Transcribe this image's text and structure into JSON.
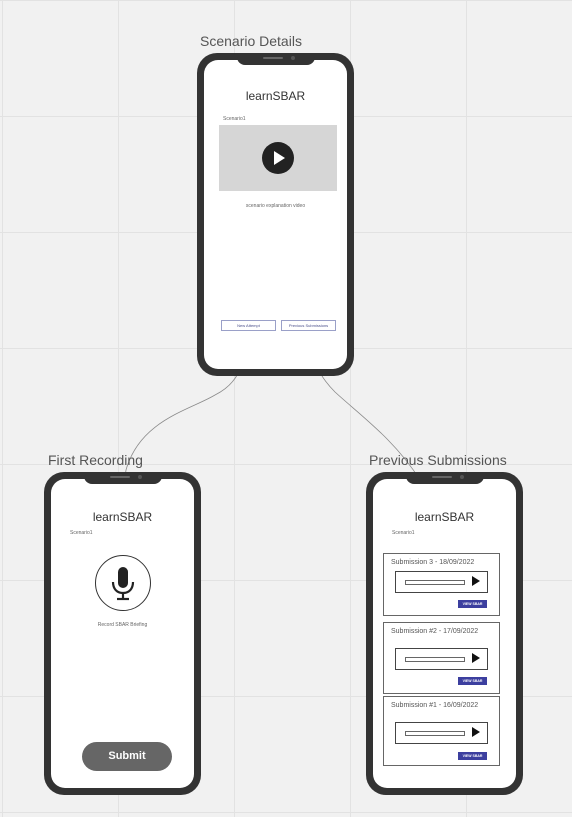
{
  "frames": {
    "scenario_details": {
      "title": "Scenario Details",
      "app_title": "learnSBAR",
      "scenario_label": "Scenario1",
      "video_caption": "scenario explanation video",
      "new_attempt_button": "New Attempt",
      "previous_submissions_button": "Previous Submissions"
    },
    "first_recording": {
      "title": "First Recording",
      "app_title": "learnSBAR",
      "scenario_label": "Scenario1",
      "record_caption": "Record  SBAR Briefing",
      "submit_button": "Submit"
    },
    "previous_submissions": {
      "title": "Previous Submissions",
      "app_title": "learnSBAR",
      "scenario_label": "Scenario1",
      "submissions": [
        {
          "label": "Submission 3  - 18/09/2022",
          "view_button": "VIEW SBAR"
        },
        {
          "label": "Submission #2 - 17/09/2022",
          "view_button": "VIEW SBAR"
        },
        {
          "label": "Submission #1 - 16/09/2022",
          "view_button": "VIEW SBAR"
        }
      ]
    }
  },
  "icons": {
    "play": "play-icon",
    "microphone": "microphone-icon",
    "audio_play": "play-icon"
  },
  "colors": {
    "phone_body": "#333333",
    "video_placeholder": "#d6d6d6",
    "submit_button": "#666666",
    "view_button": "#3c3f9f",
    "canvas": "#f1f1f1"
  }
}
